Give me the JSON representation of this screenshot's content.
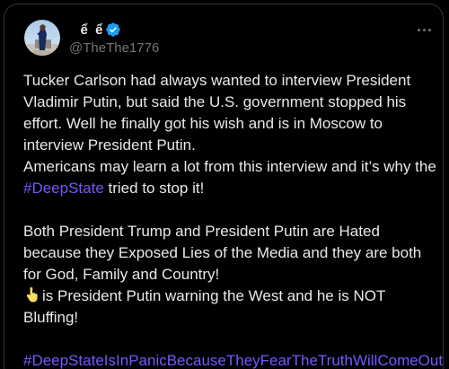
{
  "post": {
    "display_name": "   ể  ể",
    "handle": "@TheThe1776",
    "more_label": "More",
    "lines": [
      "Tucker Carlson had always wanted to interview President",
      "Vladimir Putin, but said the U.S. government stopped his",
      "effort.  Well he finally got his wish and is in Moscow to",
      "interview President Putin.",
      "Americans may learn a lot from this interview and it’s why the"
    ],
    "line6_hashtag": "#DeepState",
    "line6_rest": " tried to stop it!",
    "paragraph2": [
      "Both President Trump and President Putin are Hated",
      "because they Exposed Lies of the Media and they are both",
      "for God, Family and Country!"
    ],
    "line_emoji_rest": "is President Putin warning the West and he is NOT",
    "line_bluffing": "Bluffing!",
    "final_hashtag": "#DeepStateIsInPanicBecauseTheyFearTheTruthWillComeOut"
  },
  "icons": {
    "verified": "verified-badge-icon",
    "pointing_down": "backhand-index-pointing-down-emoji",
    "more": "more-horizontal-icon"
  },
  "colors": {
    "background": "#000000",
    "text": "#e7e9ea",
    "secondary": "#71767b",
    "hashtag": "#7856ff",
    "verified": "#1d9bf0"
  }
}
